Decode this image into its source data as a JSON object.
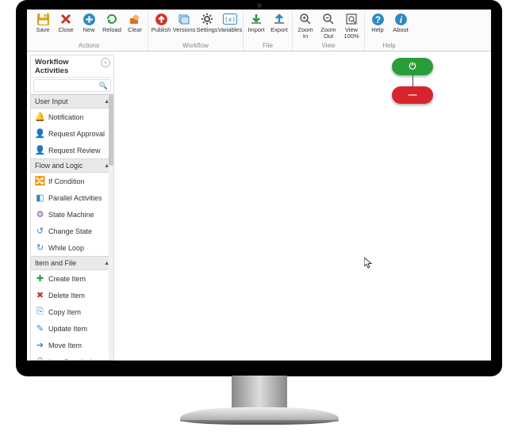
{
  "ribbon": {
    "groups": [
      {
        "title": "Actions",
        "buttons": [
          {
            "name": "save-button",
            "label": "Save",
            "icon": "save",
            "color": "#d4a017"
          },
          {
            "name": "close-button",
            "label": "Close",
            "icon": "x",
            "color": "#c0392b"
          },
          {
            "name": "new-button",
            "label": "New",
            "icon": "circle-plus",
            "color": "#2d88c4"
          },
          {
            "name": "reload-button",
            "label": "Reload",
            "icon": "reload",
            "color": "#2a9d3a"
          },
          {
            "name": "clear-button",
            "label": "Clear",
            "icon": "clear",
            "color": "#e56b1f"
          }
        ]
      },
      {
        "title": "Workflow",
        "buttons": [
          {
            "name": "publish-button",
            "label": "Publish",
            "icon": "upload-circle",
            "color": "#d0352b"
          },
          {
            "name": "versions-button",
            "label": "Versions",
            "icon": "stack",
            "color": "#2d88c4"
          },
          {
            "name": "settings-button",
            "label": "Settings",
            "icon": "gear",
            "color": "#555"
          },
          {
            "name": "variables-button",
            "label": "Variables",
            "icon": "brackets",
            "color": "#2d88c4"
          }
        ]
      },
      {
        "title": "File",
        "buttons": [
          {
            "name": "import-button",
            "label": "Import",
            "icon": "arrow-down",
            "color": "#2a9d3a"
          },
          {
            "name": "export-button",
            "label": "Export",
            "icon": "arrow-up",
            "color": "#2d88c4"
          }
        ]
      },
      {
        "title": "View",
        "buttons": [
          {
            "name": "zoom-in-button",
            "label": "Zoom\nIn",
            "icon": "zoom-in",
            "color": "#555"
          },
          {
            "name": "zoom-out-button",
            "label": "Zoom\nOut",
            "icon": "zoom-out",
            "color": "#555"
          },
          {
            "name": "view-100-button",
            "label": "View\n100%",
            "icon": "fit",
            "color": "#555"
          }
        ]
      },
      {
        "title": "Help",
        "buttons": [
          {
            "name": "help-button",
            "label": "Help",
            "icon": "help",
            "color": "#2d88c4"
          },
          {
            "name": "about-button",
            "label": "About",
            "icon": "info",
            "color": "#2d88c4"
          }
        ]
      }
    ]
  },
  "sidebar": {
    "title": "Workflow\nActivities",
    "search_placeholder": "",
    "categories": [
      {
        "name": "User Input",
        "items": [
          {
            "label": "Notification",
            "icon": "🔔",
            "color": "#e5a100"
          },
          {
            "label": "Request Approval",
            "icon": "👤",
            "color": "#c0392b"
          },
          {
            "label": "Request Review",
            "icon": "👤",
            "color": "#2d88c4"
          }
        ]
      },
      {
        "name": "Flow and Logic",
        "items": [
          {
            "label": "If Condition",
            "icon": "🔀",
            "color": "#2a9d3a"
          },
          {
            "label": "Parallel Activities",
            "icon": "◧",
            "color": "#2d88c4"
          },
          {
            "label": "State Machine",
            "icon": "⚙",
            "color": "#7a4a9c"
          },
          {
            "label": "Change State",
            "icon": "↺",
            "color": "#2d88c4"
          },
          {
            "label": "While Loop",
            "icon": "↻",
            "color": "#2d88c4"
          }
        ]
      },
      {
        "name": "Item and File",
        "items": [
          {
            "label": "Create Item",
            "icon": "✚",
            "color": "#2a9d3a"
          },
          {
            "label": "Delete Item",
            "icon": "✖",
            "color": "#c0392b"
          },
          {
            "label": "Copy Item",
            "icon": "⎘",
            "color": "#2d88c4"
          },
          {
            "label": "Update Item",
            "icon": "✎",
            "color": "#2d88c4"
          },
          {
            "label": "Move Item",
            "icon": "➔",
            "color": "#2d88c4"
          },
          {
            "label": "Item Permissions",
            "icon": "🔒",
            "color": "#888"
          }
        ]
      }
    ]
  },
  "canvas": {
    "start_glyph": "⏻",
    "end_glyph": "—"
  }
}
